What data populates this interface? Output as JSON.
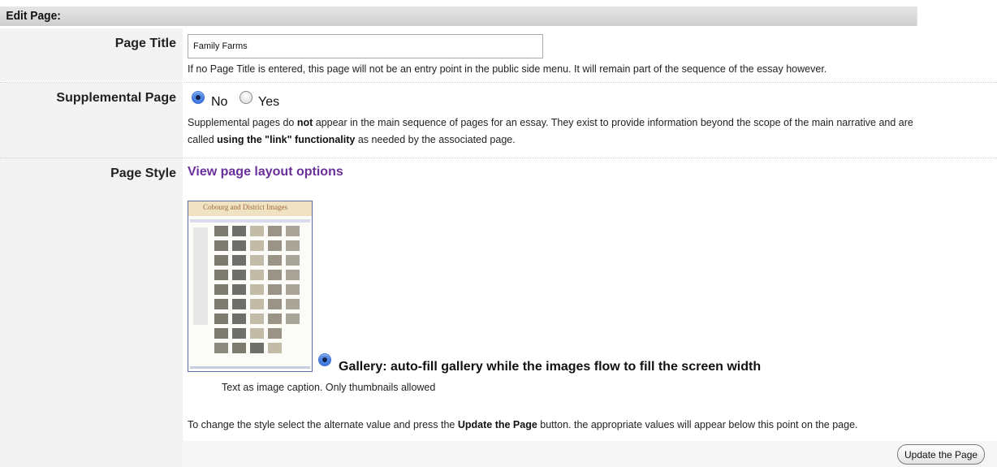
{
  "header": {
    "title": "Edit Page:"
  },
  "page_title": {
    "label": "Page Title",
    "value": "Family Farms",
    "help": "If no Page Title is entered, this page will not be an entry point in the public side menu. It will remain part of the sequence of the essay however."
  },
  "supplemental": {
    "label": "Supplemental Page",
    "options": [
      {
        "label": "No",
        "checked": true
      },
      {
        "label": "Yes",
        "checked": false
      }
    ],
    "help_line1_pre": "Supplemental pages do ",
    "help_line1_bold": "not",
    "help_line1_post": " appear in the main sequence of pages for an essay. They exist to provide information beyond the scope of the main narrative and are",
    "help_line2_pre": "called ",
    "help_line2_bold": "using the \"link\" functionality",
    "help_line2_post": " as needed by the associated page."
  },
  "page_style": {
    "label": "Page Style",
    "link": "View page layout options",
    "thumbnail_title": "Cobourg and District Images",
    "option_label": "Gallery: auto-fill gallery while the images flow to fill the screen width",
    "option_checked": true,
    "caption_note": "Text as image caption. Only thumbnails allowed",
    "instruction_pre": "To change the style select the alternate value and press the ",
    "instruction_bold": "Update the Page",
    "instruction_post": " button. the appropriate values will appear below this point on the page."
  },
  "actions": {
    "update_label": "Update the Page"
  },
  "colors": {
    "link": "#6a2f9a",
    "radio_selected": "#2a63d0",
    "header_bg": "#d6d6d6"
  }
}
